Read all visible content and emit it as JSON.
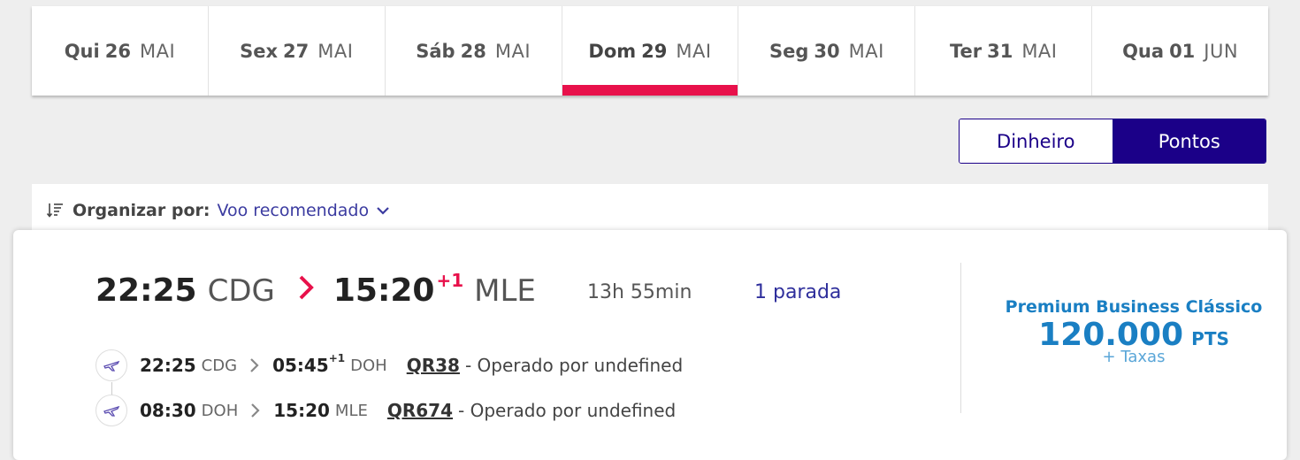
{
  "dates": [
    {
      "dow": "Qui",
      "day": "26",
      "mon": "MAI",
      "active": false
    },
    {
      "dow": "Sex",
      "day": "27",
      "mon": "MAI",
      "active": false
    },
    {
      "dow": "Sáb",
      "day": "28",
      "mon": "MAI",
      "active": false
    },
    {
      "dow": "Dom",
      "day": "29",
      "mon": "MAI",
      "active": true
    },
    {
      "dow": "Seg",
      "day": "30",
      "mon": "MAI",
      "active": false
    },
    {
      "dow": "Ter",
      "day": "31",
      "mon": "MAI",
      "active": false
    },
    {
      "dow": "Qua",
      "day": "01",
      "mon": "JUN",
      "active": false
    }
  ],
  "toggle": {
    "money": "Dinheiro",
    "points": "Pontos",
    "selected": "points"
  },
  "sort": {
    "label": "Organizar por:",
    "value": "Voo recomendado"
  },
  "flight": {
    "dep_time": "22:25",
    "dep_airport": "CDG",
    "arr_time": "15:20",
    "arr_day_offset": "+1",
    "arr_airport": "MLE",
    "duration": "13h 55min",
    "stops": "1 parada",
    "segments": [
      {
        "dep_time": "22:25",
        "dep_airport": "CDG",
        "arr_time": "05:45",
        "arr_offset": "+1",
        "arr_airport": "DOH",
        "flight_no": "QR38",
        "operated": "- Operado por undefined"
      },
      {
        "dep_time": "08:30",
        "dep_airport": "DOH",
        "arr_time": "15:20",
        "arr_offset": "",
        "arr_airport": "MLE",
        "flight_no": "QR674",
        "operated": "- Operado por undefined"
      }
    ],
    "price": {
      "cabin": "Premium Business Clássico",
      "points": "120.000",
      "unit": "PTS",
      "taxes": "+ Taxas"
    }
  },
  "colors": {
    "accent": "#e8114b",
    "brand": "#1b0088",
    "price": "#1a7fc3"
  }
}
